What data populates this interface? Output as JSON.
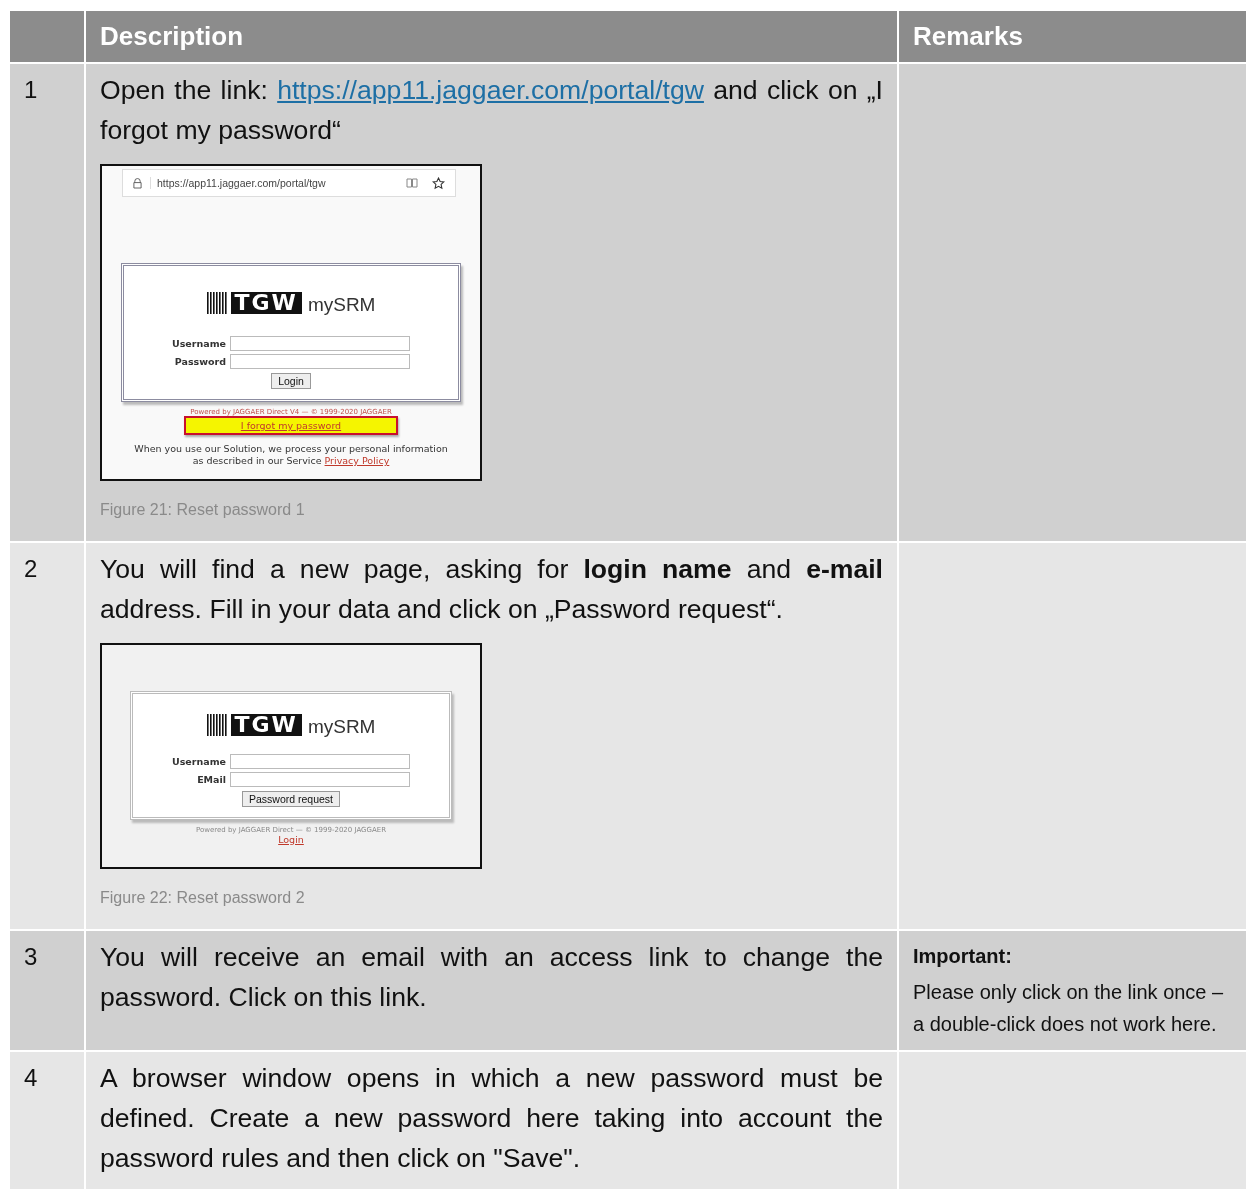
{
  "table": {
    "columns": [
      {
        "label": "Description"
      },
      {
        "label": "Remarks"
      }
    ],
    "rows": [
      {
        "number": "1",
        "description": [
          {
            "kind": "paragraph",
            "parts": [
              {
                "text": "Open the link: ",
                "link": false
              },
              {
                "text": "https://app11.jaggaer.com/portal/tgw",
                "link": true
              },
              {
                "text": " and click on „I forgot my password“",
                "link": false
              }
            ]
          },
          {
            "kind": "figure",
            "screen": {
              "url": "https://app11.jaggaer.com/portal/tgw",
              "logo": {
                "mark": "TGW",
                "product": "mySRM"
              },
              "fields": [
                {
                  "label": "Username"
                },
                {
                  "label": "Password"
                }
              ],
              "button": "Login",
              "footer": "Powered by JAGGAER Direct V4 — © 1999-2020 JAGGAER",
              "link": {
                "text": "I forgot my password",
                "highlighted": true
              },
              "notice": [
                {
                  "text": "When you use our Solution, we process your personal information as described in our Service ",
                  "link": false
                },
                {
                  "text": "Privacy Policy",
                  "link": true
                }
              ]
            },
            "caption": "Figure 21: Reset password 1"
          }
        ],
        "remarks": []
      },
      {
        "number": "2",
        "description": [
          {
            "kind": "paragraph",
            "parts": [
              {
                "text": "You will find a new page, asking for **login name** and **e-mail** address. Fill in your data and click on „Password request“.",
                "link": false
              }
            ]
          },
          {
            "kind": "figure",
            "screen": {
              "logo": {
                "mark": "TGW",
                "product": "mySRM"
              },
              "fields": [
                {
                  "label": "Username"
                },
                {
                  "label": "EMail"
                }
              ],
              "button": "Password request",
              "footer": "Powered by JAGGAER Direct — © 1999-2020 JAGGAER",
              "link": {
                "text": "Login",
                "highlighted": false
              }
            },
            "caption": "Figure 22: Reset password 2"
          }
        ],
        "remarks": []
      },
      {
        "number": "3",
        "description": [
          {
            "kind": "paragraph",
            "parts": [
              {
                "text": "You will receive an email with an access link to change the password. Click on this link.",
                "link": false
              }
            ]
          }
        ],
        "remarks": [
          {
            "kind": "heading",
            "text": "Important:"
          },
          {
            "kind": "note",
            "text": "Please only click on the link once – a double-click does not work here."
          }
        ]
      },
      {
        "number": "4",
        "description": [
          {
            "kind": "paragraph",
            "parts": [
              {
                "text": "A browser window opens in which a new password must be defined. Create a new password here taking into account the password rules and then click on \"Save\".",
                "link": false
              }
            ]
          }
        ],
        "remarks": []
      }
    ]
  }
}
